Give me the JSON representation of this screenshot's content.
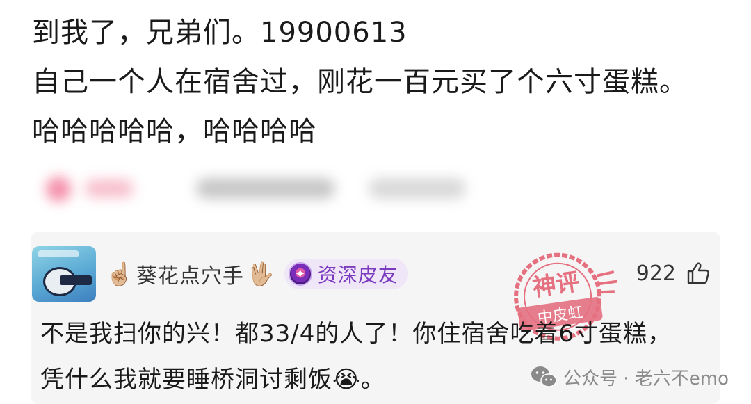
{
  "post": {
    "line1": "到我了，兄弟们。19900613",
    "line2": "自己一个人在宿舍过，刚花一百元买了个六寸蛋糕。",
    "line3": "哈哈哈哈哈，哈哈哈哈"
  },
  "comment": {
    "username": "葵花点穴手",
    "hand_left": "☝🏼",
    "hand_right": "🖖🏼",
    "badge_label": "资深皮友",
    "likes": "922",
    "text_line1": "不是我扫你的兴！都33/4的人了！你住宿舍吃着6寸蛋糕，",
    "text_line2": "凭什么我就要睡桥洞讨剩饭",
    "text_line2_emoji": "😭",
    "text_line2_end": "。"
  },
  "stamp": {
    "line1": "神评",
    "line2": "中皮虹"
  },
  "watermark": {
    "text": "公众号 · 老六不emo"
  },
  "colors": {
    "badge_bg": "#efe6f7",
    "badge_text": "#7a3bbf",
    "card_bg": "#f5f5f5",
    "stamp": "#e0455a"
  }
}
